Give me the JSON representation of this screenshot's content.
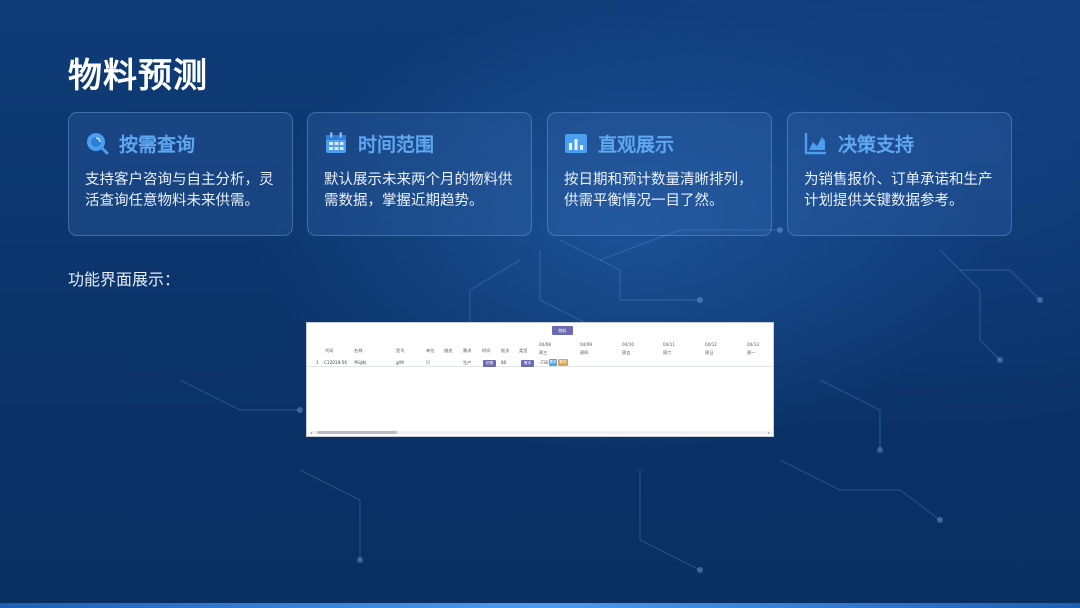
{
  "page": {
    "title": "物料预测",
    "subtitle": "功能界面展示："
  },
  "cards": [
    {
      "icon": "search-icon",
      "title": "按需查询",
      "desc": "支持客户咨询与自主分析，灵活查询任意物料未来供需。"
    },
    {
      "icon": "calendar-icon",
      "title": "时间范围",
      "desc": "默认展示未来两个月的物料供需数据，掌握近期趋势。"
    },
    {
      "icon": "bar-chart-icon",
      "title": "直观展示",
      "desc": "按日期和预计数量清晰排列，供需平衡情况一目了然。"
    },
    {
      "icon": "area-chart-icon",
      "title": "决策支持",
      "desc": "为销售报价、订单承诺和生产计划提供关键数据参考。"
    }
  ],
  "colors": {
    "accent": "#5ea8f2",
    "background": "#0b356c"
  },
  "screenshot": {
    "top_button": "物料",
    "headers": [
      "代码",
      "名称",
      "型号",
      "单位",
      "描述",
      "需求",
      "时间",
      "批次",
      "类型"
    ],
    "dates": [
      {
        "date": "04/08",
        "day": "周三"
      },
      {
        "date": "04/09",
        "day": "周四"
      },
      {
        "date": "04/10",
        "day": "周五"
      },
      {
        "date": "04/11",
        "day": "周六"
      },
      {
        "date": "04/12",
        "day": "周日"
      },
      {
        "date": "04/13",
        "day": "周一"
      }
    ],
    "row": {
      "index": "1",
      "code": "C12019-56",
      "name": "甲动料",
      "model": "g/M",
      "unit": "只",
      "desc": "生产",
      "tag1": "供需",
      "qty": "80",
      "tag2": "需求",
      "value": "-730",
      "tag3": "需求",
      "tag4": "需求"
    }
  }
}
